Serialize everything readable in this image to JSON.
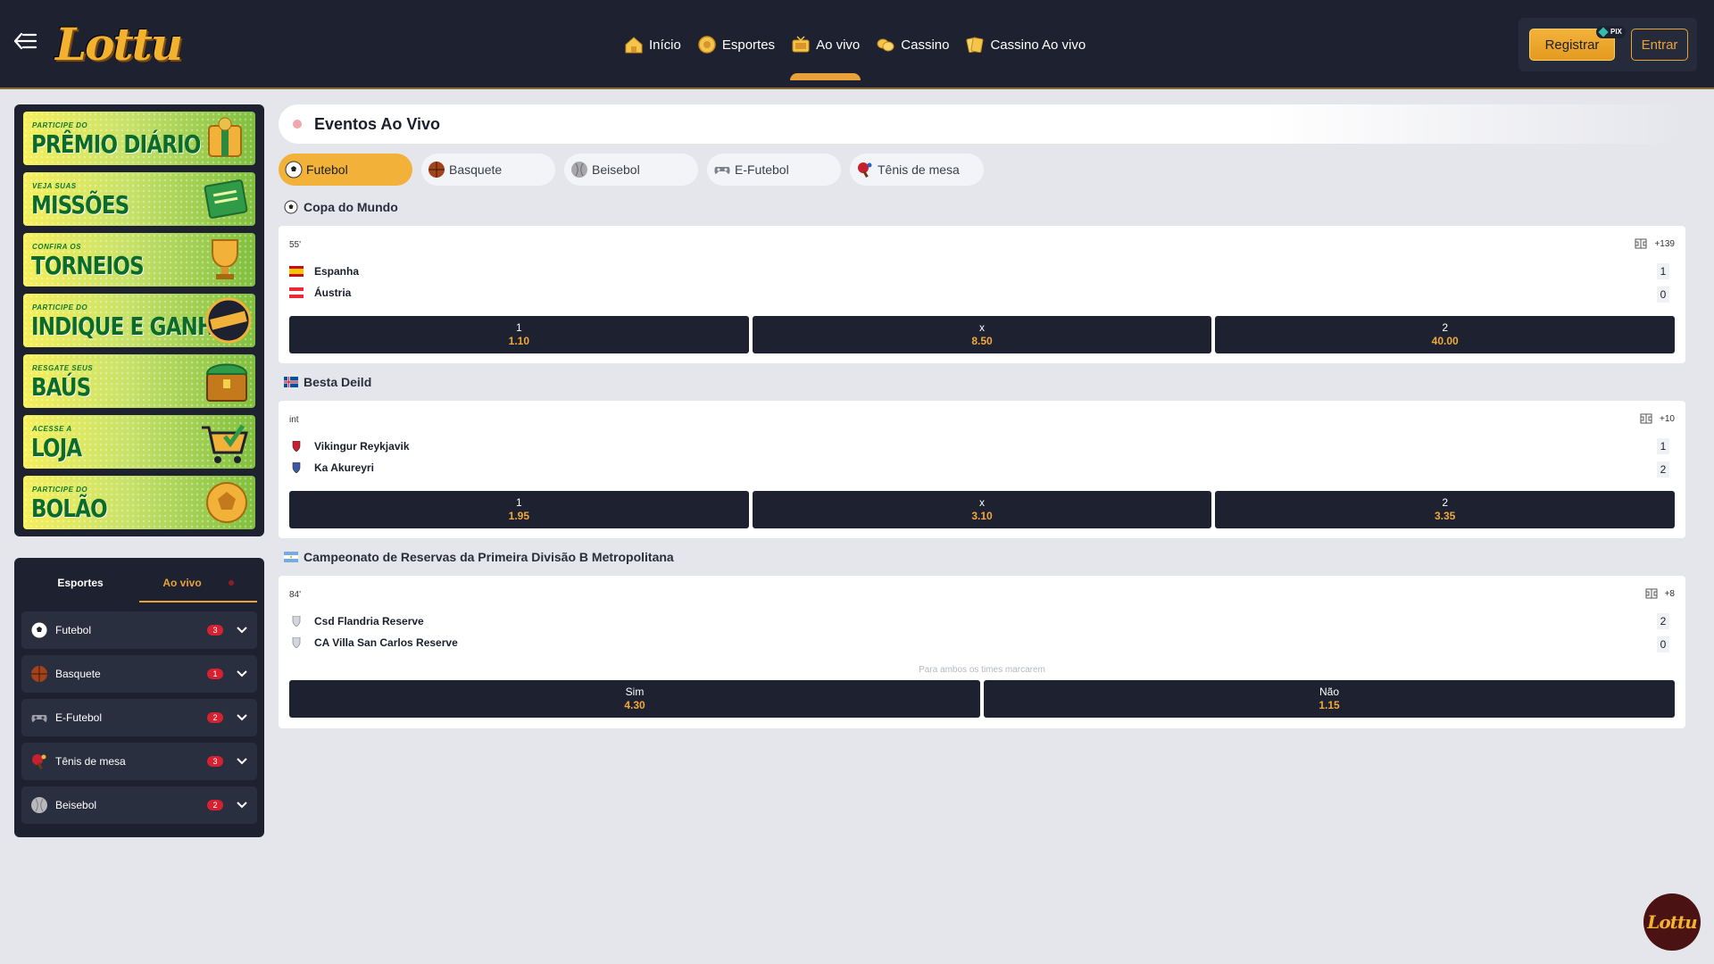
{
  "header": {
    "logo_text": "Lottu",
    "nav": [
      {
        "label": "Início",
        "icon": "house-icon"
      },
      {
        "label": "Esportes",
        "icon": "coin-icon"
      },
      {
        "label": "Ao vivo",
        "icon": "tv-icon"
      },
      {
        "label": "Cassino",
        "icon": "coins-icon"
      },
      {
        "label": "Cassino Ao vivo",
        "icon": "cards-icon"
      }
    ],
    "active_nav": "Ao vivo",
    "register_label": "Registrar",
    "pix_label": "PIX",
    "login_label": "Entrar"
  },
  "promos": [
    {
      "small": "PARTICIPE DO",
      "big": "PRÊMIO DIÁRIO"
    },
    {
      "small": "VEJA SUAS",
      "big": "MISSÕES"
    },
    {
      "small": "CONFIRA OS",
      "big": "TORNEIOS"
    },
    {
      "small": "PARTICIPE DO",
      "big": "INDIQUE E GANHE"
    },
    {
      "small": "RESGATE SEUS",
      "big": "BAÚS"
    },
    {
      "small": "ACESSE A",
      "big": "LOJA"
    },
    {
      "small": "PARTICIPE DO",
      "big": "BOLÃO"
    }
  ],
  "sidebar": {
    "tab_sports": "Esportes",
    "tab_live": "Ao vivo",
    "items": [
      {
        "name": "Futebol",
        "count": "3"
      },
      {
        "name": "Basquete",
        "count": "1"
      },
      {
        "name": "E-Futebol",
        "count": "2"
      },
      {
        "name": "Tênis de mesa",
        "count": "3"
      },
      {
        "name": "Beisebol",
        "count": "2"
      }
    ]
  },
  "main": {
    "title": "Eventos Ao Vivo",
    "sport_tabs": [
      "Futebol",
      "Basquete",
      "Beisebol",
      "E-Futebol",
      "Tênis de mesa"
    ],
    "leagues": [
      {
        "name": "Copa do Mundo",
        "event": {
          "time": "55'",
          "more": "+139",
          "teams": [
            {
              "name": "Espanha",
              "score": "1"
            },
            {
              "name": "Áustria",
              "score": "0"
            }
          ],
          "odds": [
            {
              "label": "1",
              "value": "1.10"
            },
            {
              "label": "x",
              "value": "8.50"
            },
            {
              "label": "2",
              "value": "40.00"
            }
          ]
        }
      },
      {
        "name": "Besta Deild",
        "event": {
          "time": "int",
          "more": "+10",
          "teams": [
            {
              "name": "Vikingur Reykjavik",
              "score": "1"
            },
            {
              "name": "Ka Akureyri",
              "score": "2"
            }
          ],
          "odds": [
            {
              "label": "1",
              "value": "1.95"
            },
            {
              "label": "x",
              "value": "3.10"
            },
            {
              "label": "2",
              "value": "3.35"
            }
          ]
        }
      },
      {
        "name": "Campeonato de Reservas da Primeira Divisão B Metropolitana",
        "event": {
          "time": "84'",
          "more": "+8",
          "teams": [
            {
              "name": "Csd Flandria Reserve",
              "score": "2"
            },
            {
              "name": "CA Villa San Carlos Reserve",
              "score": "0"
            }
          ],
          "market": "Para ambos os times marcarem",
          "odds": [
            {
              "label": "Sim",
              "value": "4.30"
            },
            {
              "label": "Não",
              "value": "1.15"
            }
          ]
        }
      }
    ]
  },
  "colors": {
    "accent": "#f2b23a",
    "header_bg": "#1d2130",
    "odd_bg": "#1d2130",
    "odd_value": "#f2a93a",
    "count_badge": "#d62230"
  }
}
